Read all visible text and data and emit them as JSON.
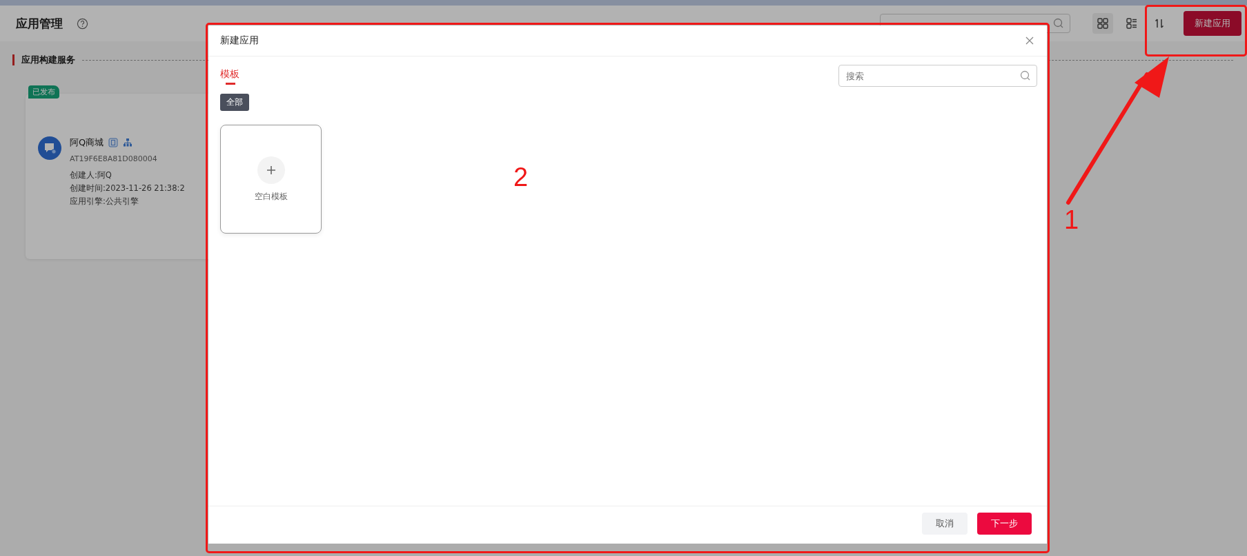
{
  "page": {
    "title": "应用管理",
    "section_title": "应用构建服务",
    "new_button": "新建应用"
  },
  "app_cards": [
    {
      "status": "已发布",
      "name": "阿Q商城",
      "code": "AT19F6E8A81D080004",
      "details": [
        "创建人:阿Q",
        "创建时间:2023-11-26 21:38:2",
        "应用引擎:公共引擎"
      ]
    }
  ],
  "view_modes": [
    {
      "kind": "grid",
      "selected": true
    },
    {
      "kind": "list",
      "selected": false
    }
  ],
  "dialog": {
    "title": "新建应用",
    "tabs": [
      {
        "label": "模板",
        "selected": true
      }
    ],
    "search": {
      "placeholder": "搜索"
    },
    "filters": [
      {
        "label": "全部",
        "selected": true
      }
    ],
    "templates": [
      {
        "label": "空白模板"
      }
    ],
    "buttons": [
      {
        "label": "取消",
        "kind": "secondary"
      },
      {
        "label": "下一步",
        "kind": "primary"
      }
    ]
  },
  "annotations": [
    {
      "label": "1"
    },
    {
      "label": "2"
    }
  ]
}
